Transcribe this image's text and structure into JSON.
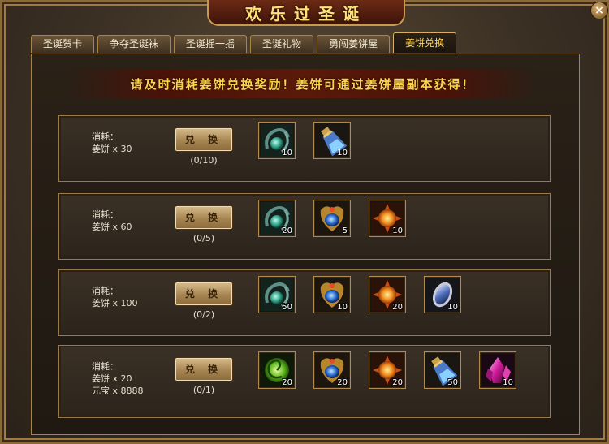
{
  "window": {
    "title": "欢乐过圣诞",
    "close_glyph": "×"
  },
  "tabs": [
    {
      "label": "圣诞贺卡"
    },
    {
      "label": "争夺圣诞袜"
    },
    {
      "label": "圣诞摇一摇"
    },
    {
      "label": "圣诞礼物"
    },
    {
      "label": "勇闯姜饼屋"
    },
    {
      "label": "姜饼兑换",
      "active": true
    }
  ],
  "notice": "请及时消耗姜饼兑换奖励！姜饼可通过姜饼屋副本获得！",
  "rows": [
    {
      "cost_label": "消耗：",
      "costs": [
        "姜饼 x 30"
      ],
      "button_label": "兑 换",
      "progress": "(0/10)",
      "rewards": [
        {
          "icon": "jade-orb-icon",
          "count": "10"
        },
        {
          "icon": "mana-flask-icon",
          "count": "10"
        }
      ]
    },
    {
      "cost_label": "消耗：",
      "costs": [
        "姜饼 x 60"
      ],
      "button_label": "兑 换",
      "progress": "(0/5)",
      "rewards": [
        {
          "icon": "jade-orb-icon",
          "count": "20"
        },
        {
          "icon": "blue-crest-icon",
          "count": "5"
        },
        {
          "icon": "sun-emblem-icon",
          "count": "10"
        }
      ]
    },
    {
      "cost_label": "消耗：",
      "costs": [
        "姜饼 x 100"
      ],
      "button_label": "兑 换",
      "progress": "(0/2)",
      "rewards": [
        {
          "icon": "jade-orb-icon",
          "count": "50"
        },
        {
          "icon": "blue-crest-icon",
          "count": "10"
        },
        {
          "icon": "sun-emblem-icon",
          "count": "20"
        },
        {
          "icon": "mirror-gem-icon",
          "count": "10"
        }
      ]
    },
    {
      "cost_label": "消耗：",
      "costs": [
        "姜饼 x 20",
        "元宝 x 8888"
      ],
      "button_label": "兑 换",
      "progress": "(0/1)",
      "rewards": [
        {
          "icon": "green-vortex-icon",
          "count": "20"
        },
        {
          "icon": "blue-crest-icon",
          "count": "20"
        },
        {
          "icon": "sun-emblem-icon",
          "count": "20"
        },
        {
          "icon": "mana-flask-icon",
          "count": "50"
        },
        {
          "icon": "pink-crystal-icon",
          "count": "10"
        }
      ]
    }
  ]
}
